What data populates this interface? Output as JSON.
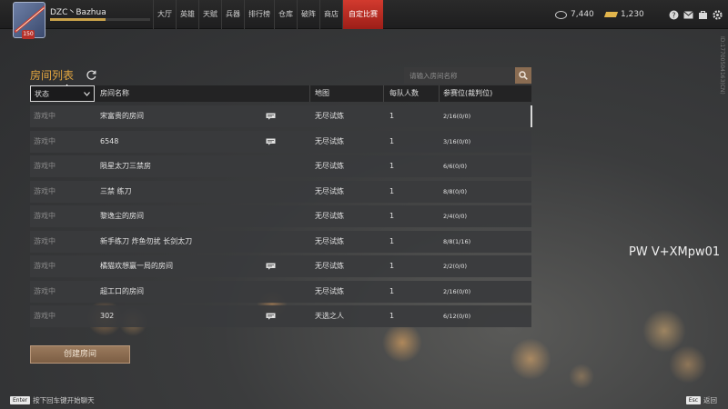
{
  "player": {
    "name": "DZC丶Bazhua",
    "level_badge": "150",
    "xp_fraction": 0.55
  },
  "nav": {
    "items": [
      {
        "label": "大厅",
        "active": false
      },
      {
        "label": "英雄",
        "active": false
      },
      {
        "label": "天赋",
        "active": false
      },
      {
        "label": "兵器",
        "active": false
      },
      {
        "label": "排行榜",
        "active": false
      },
      {
        "label": "仓库",
        "active": false
      },
      {
        "label": "破阵",
        "active": false
      },
      {
        "label": "商店",
        "active": false
      },
      {
        "label": "自定比赛",
        "active": true
      }
    ]
  },
  "currency": {
    "coins": "7,440",
    "gold": "1,230"
  },
  "top_icons": [
    "help-icon",
    "mail-icon",
    "shop-icon",
    "settings-icon"
  ],
  "room_list": {
    "title": "房间列表",
    "search_placeholder": "请输入房间名称",
    "headers": {
      "status_filter": "状态",
      "name": "房间名称",
      "map": "地图",
      "team_size": "每队人数",
      "slots": "参赛位(裁判位)"
    },
    "rows": [
      {
        "status": "游戏中",
        "name": "宋富贵的房间",
        "chat": true,
        "map": "无尽试炼",
        "team_size": "1",
        "slots": "2/16(0/0)"
      },
      {
        "status": "游戏中",
        "name": "6548",
        "chat": true,
        "map": "无尽试炼",
        "team_size": "1",
        "slots": "3/16(0/0)"
      },
      {
        "status": "游戏中",
        "name": "陨星太刀三禁房",
        "chat": false,
        "map": "无尽试炼",
        "team_size": "1",
        "slots": "6/6(0/0)"
      },
      {
        "status": "游戏中",
        "name": "三禁 练刀",
        "chat": false,
        "map": "无尽试炼",
        "team_size": "1",
        "slots": "8/8(0/0)"
      },
      {
        "status": "游戏中",
        "name": "黎逸尘的房间",
        "chat": false,
        "map": "无尽试炼",
        "team_size": "1",
        "slots": "2/4(0/0)"
      },
      {
        "status": "游戏中",
        "name": "新手练刀  炸鱼勿扰  长剑太刀",
        "chat": false,
        "map": "无尽试炼",
        "team_size": "1",
        "slots": "8/8(1/16)"
      },
      {
        "status": "游戏中",
        "name": "橘猫欢想赢一局的房间",
        "chat": true,
        "map": "无尽试炼",
        "team_size": "1",
        "slots": "2/2(0/0)"
      },
      {
        "status": "游戏中",
        "name": "超工口的房间",
        "chat": false,
        "map": "无尽试炼",
        "team_size": "1",
        "slots": "2/16(0/0)"
      },
      {
        "status": "游戏中",
        "name": "302",
        "chat": true,
        "map": "天选之人",
        "team_size": "1",
        "slots": "6/12(0/0)"
      }
    ],
    "create_button": "创建房间"
  },
  "vertical_id": "ID:17700504163(CN)",
  "watermark": "PW V+XMpw01",
  "footer": {
    "left_key": "Enter",
    "left_text": "按下回车键开始聊天",
    "right_key": "Esc",
    "right_text": "返回"
  },
  "colors": {
    "accent_red": "#d23a2e",
    "title_orange": "#e2a640",
    "button_brown": "#8a6c52"
  }
}
